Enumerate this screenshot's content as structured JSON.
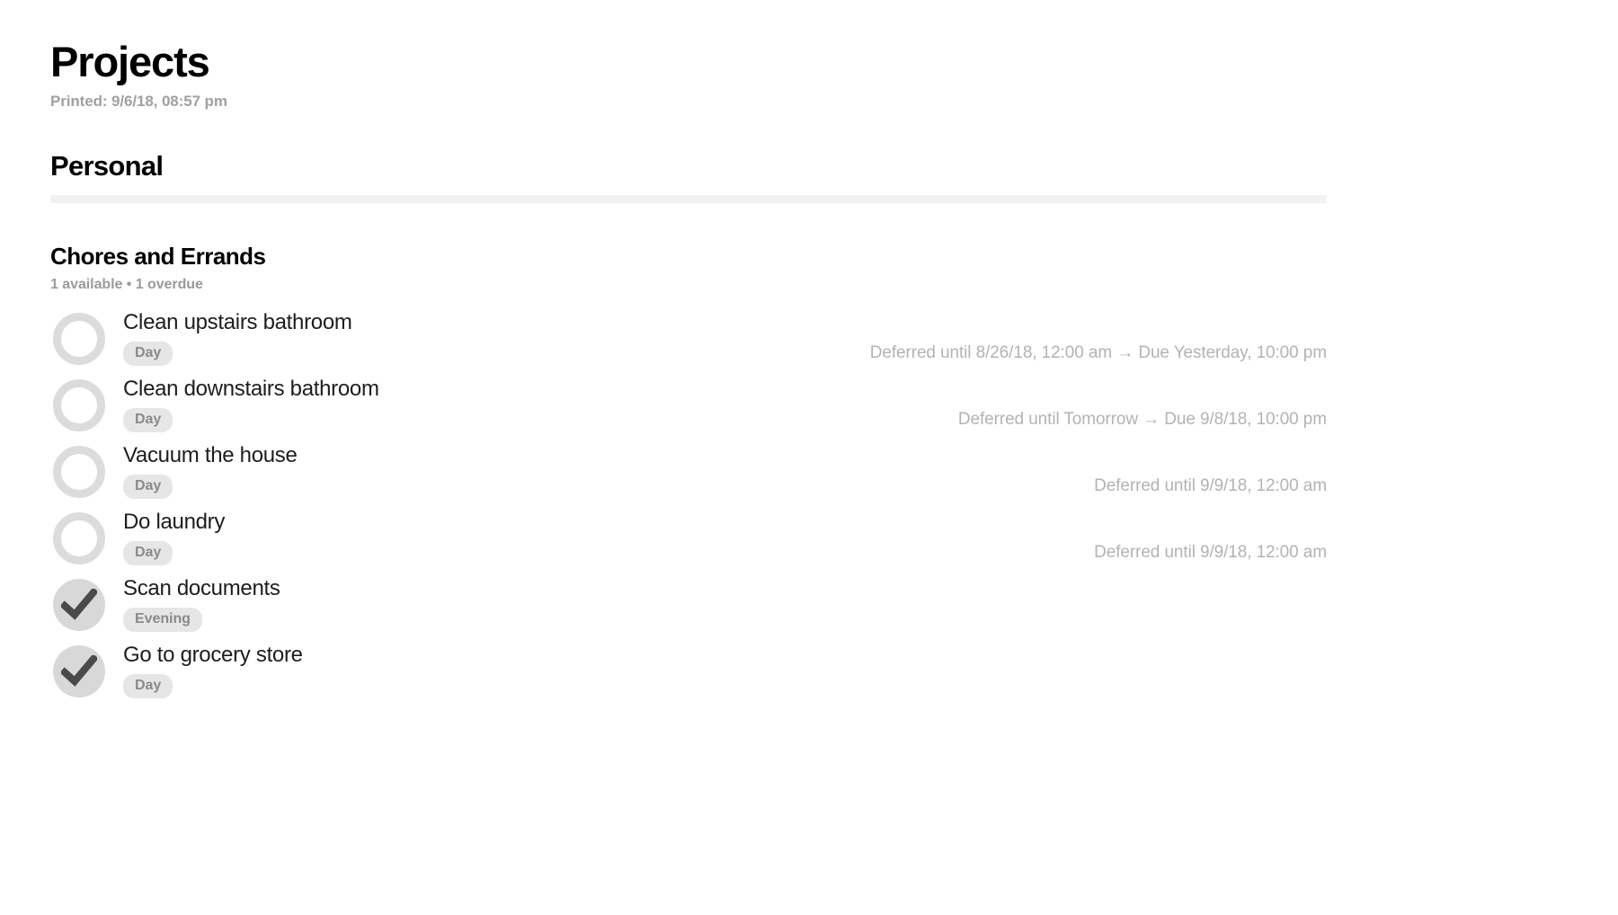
{
  "document": {
    "title": "Projects",
    "printed": "Printed: 9/6/18, 08:57 pm"
  },
  "folders": [
    {
      "name": "Personal",
      "projects": [
        {
          "name": "Chores and Errands",
          "status": "1 available • 1 overdue",
          "tasks": [
            {
              "title": "Clean upstairs bathroom",
              "tag": "Day",
              "completed": false,
              "checkbox_icon": "circle-outline-icon",
              "meta": "Deferred until 8/26/18, 12:00 am → Due Yesterday, 10:00 pm"
            },
            {
              "title": "Clean downstairs bathroom",
              "tag": "Day",
              "completed": false,
              "checkbox_icon": "circle-outline-icon",
              "meta": "Deferred until Tomorrow → Due 9/8/18, 10:00 pm"
            },
            {
              "title": "Vacuum the house",
              "tag": "Day",
              "completed": false,
              "checkbox_icon": "circle-outline-icon",
              "meta": "Deferred until 9/9/18, 12:00 am"
            },
            {
              "title": "Do laundry",
              "tag": "Day",
              "completed": false,
              "checkbox_icon": "circle-outline-icon",
              "meta": "Deferred until 9/9/18, 12:00 am"
            },
            {
              "title": "Scan documents",
              "tag": "Evening",
              "completed": true,
              "checkbox_icon": "checkmark-filled-icon",
              "meta": ""
            },
            {
              "title": "Go to grocery store",
              "tag": "Day",
              "completed": true,
              "checkbox_icon": "checkmark-filled-icon",
              "meta": ""
            }
          ]
        }
      ]
    }
  ],
  "colors": {
    "text": "#1d1d1d",
    "muted": "#9a9a9a",
    "meta": "#b3b3b3",
    "pill_bg": "#e6e6e6",
    "checkbox_ring": "#dcdcdc",
    "checkbox_done_bg": "#d8d8d8",
    "checkmark": "#4a4a4a",
    "rule": "#f2f2f2"
  }
}
